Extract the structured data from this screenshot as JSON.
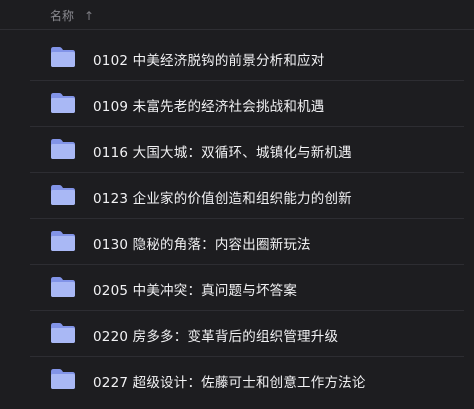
{
  "header": {
    "column_label": "名称",
    "sort_icon": "arrow-up-icon",
    "sort_glyph": "↑"
  },
  "items": [
    {
      "label": "0102 中美经济脱钩的前景分析和应对",
      "icon": "folder-icon"
    },
    {
      "label": "0109 未富先老的经济社会挑战和机遇",
      "icon": "folder-icon"
    },
    {
      "label": "0116 大国大城：双循环、城镇化与新机遇",
      "icon": "folder-icon"
    },
    {
      "label": "0123 企业家的价值创造和组织能力的创新",
      "icon": "folder-icon"
    },
    {
      "label": "0130 隐秘的角落：内容出圈新玩法",
      "icon": "folder-icon"
    },
    {
      "label": "0205 中美冲突：真问题与坏答案",
      "icon": "folder-icon"
    },
    {
      "label": "0220 房多多：变革背后的组织管理升级",
      "icon": "folder-icon"
    },
    {
      "label": "0227 超级设计：佐藤可士和创意工作方法论",
      "icon": "folder-icon"
    }
  ],
  "colors": {
    "background": "#1d1d20",
    "folder_light": "#a9b8f5",
    "folder_dark": "#8294e8",
    "text": "#f2f2f4"
  }
}
